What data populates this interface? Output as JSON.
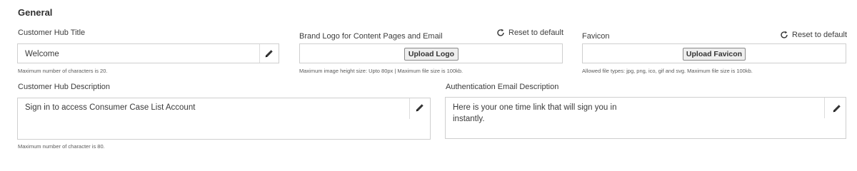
{
  "section": {
    "title": "General"
  },
  "hub_title": {
    "label": "Customer Hub Title",
    "value": "Welcome",
    "hint": "Maximum number of characters is 20."
  },
  "brand_logo": {
    "label": "Brand Logo for Content Pages and Email",
    "reset_label": "Reset to default",
    "upload_label": "Upload Logo",
    "hint": "Maximum image height size: Upto 80px | Maximum file size is 100kb."
  },
  "favicon": {
    "label": "Favicon",
    "reset_label": "Reset to default",
    "upload_label": "Upload Favicon",
    "hint": "Allowed file types: jpg, png, ico, gif and svg. Maximum file size is 100kb."
  },
  "hub_description": {
    "label": "Customer Hub Description",
    "value": "Sign in to access Consumer Case List Account",
    "hint": "Maximum number of character is 80."
  },
  "auth_email": {
    "label": "Authentication Email Description",
    "value_line1": "Here is your one time link that will sign you in",
    "value_line2": "instantly."
  },
  "icons": {
    "edit": "pencil-icon",
    "reset": "refresh-icon"
  }
}
